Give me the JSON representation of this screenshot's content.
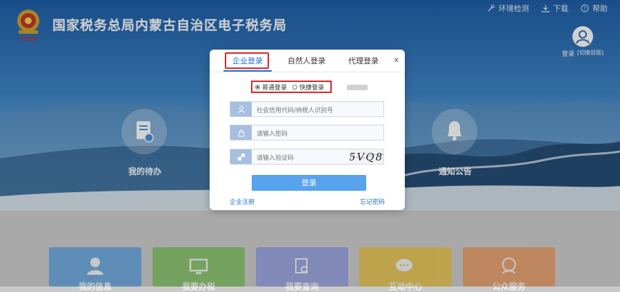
{
  "header": {
    "site_title": "国家税务总局内蒙古自治区电子税务局",
    "emblem_text": "中国税务",
    "top_links": [
      {
        "icon": "wrench-icon",
        "label": "环境检测"
      },
      {
        "icon": "download-icon",
        "label": "下载"
      },
      {
        "icon": "help-icon",
        "label": "帮助"
      }
    ],
    "user": {
      "login_label": "登录",
      "switch_label": "[切换旧版]",
      "icon": "user-avatar-icon"
    }
  },
  "features": [
    {
      "label": "我的待办",
      "icon": "document-clock-icon"
    },
    {
      "label": "通知公告",
      "icon": "bell-icon"
    }
  ],
  "tiles": [
    {
      "label": "我的信息",
      "color": "#5aa6e6",
      "icon": "person-icon"
    },
    {
      "label": "我要办税",
      "color": "#7dc35a",
      "icon": "monitor-icon"
    },
    {
      "label": "我要查询",
      "color": "#8f9ee6",
      "icon": "search-doc-icon"
    },
    {
      "label": "互动中心",
      "color": "#f0c640",
      "icon": "chat-icon"
    },
    {
      "label": "公众服务",
      "color": "#f19a5c",
      "icon": "service-icon"
    }
  ],
  "modal": {
    "tabs": [
      {
        "label": "企业登录",
        "active": true
      },
      {
        "label": "自然人登录",
        "active": false
      },
      {
        "label": "代理登录",
        "active": false
      }
    ],
    "close_label": "x",
    "login_modes": [
      {
        "label": "普通登录",
        "selected": true
      },
      {
        "label": "快捷登录",
        "selected": false
      }
    ],
    "fields": {
      "credit_code_placeholder": "社会信用代码/纳税人识别号",
      "password_placeholder": "请输入密码",
      "captcha_placeholder": "请输入验证码",
      "captcha_text": "5VQ8"
    },
    "login_button": "登录",
    "register_link": "企业注册",
    "forgot_link": "忘记密码"
  },
  "colors": {
    "accent": "#1f6fd1",
    "button": "#57a3ee",
    "highlight_box": "#e02020"
  }
}
